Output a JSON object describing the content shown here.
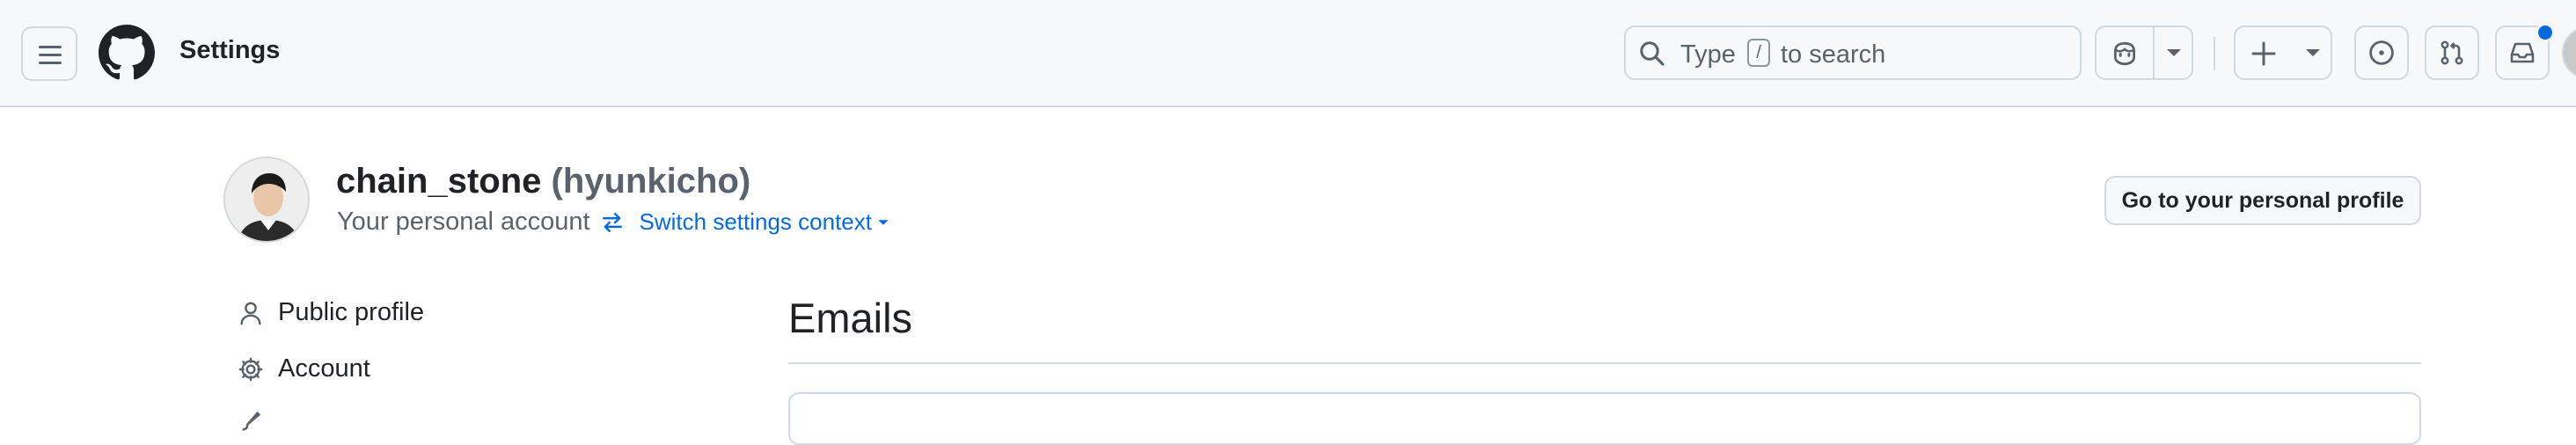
{
  "header": {
    "title": "Settings",
    "search": {
      "prefix": "Type",
      "key": "/",
      "suffix": "to search"
    }
  },
  "profile": {
    "display_name": "chain_stone",
    "login": "(hyunkicho)",
    "account_type": "Your personal account",
    "switch_label": "Switch settings context",
    "go_to_profile_label": "Go to your personal profile"
  },
  "sidebar": {
    "items": [
      {
        "label": "Public profile",
        "icon": "person-icon"
      },
      {
        "label": "Account",
        "icon": "gear-icon"
      }
    ]
  },
  "main": {
    "heading": "Emails"
  },
  "colors": {
    "accent": "#0969da",
    "header_bg": "#f6f8fa",
    "border": "#d1d9e0",
    "muted": "#59636e",
    "text": "#1f2328"
  }
}
